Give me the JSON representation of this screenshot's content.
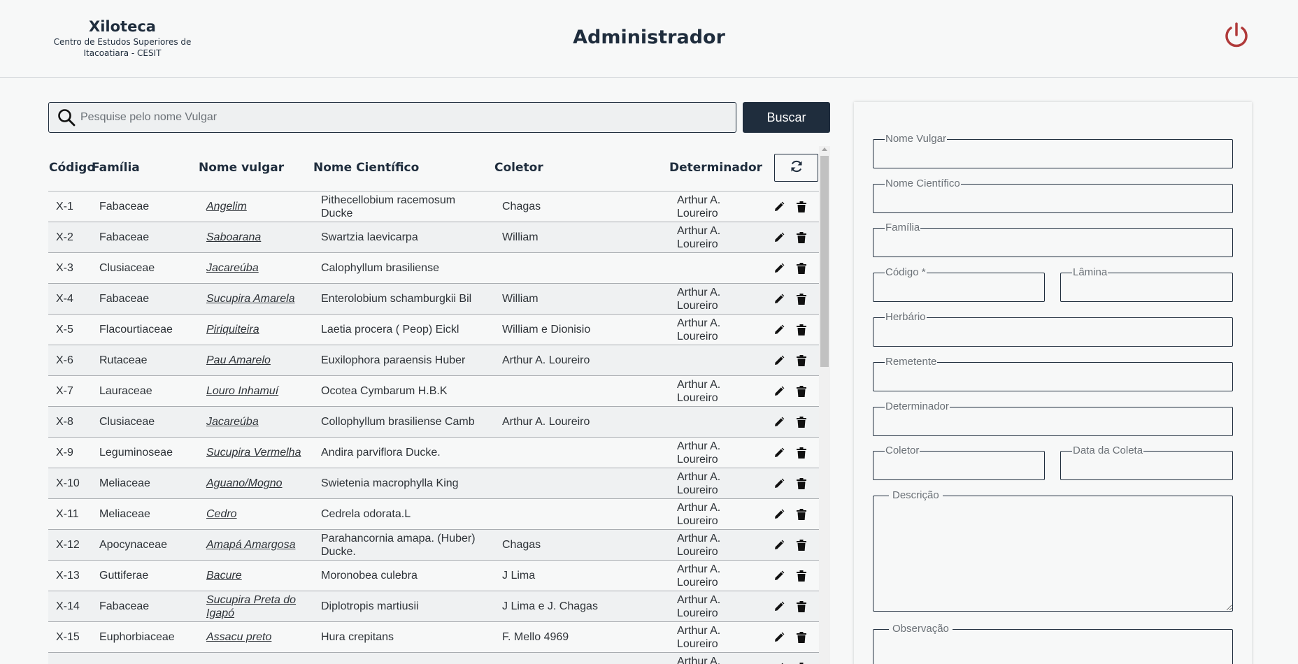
{
  "header": {
    "brand_title": "Xiloteca",
    "brand_subtitle": "Centro de Estudos Superiores de Itacoatiara - CESIT",
    "page_title": "Administrador"
  },
  "search": {
    "placeholder": "Pesquise pelo nome Vulgar",
    "value": "",
    "button_label": "Buscar"
  },
  "table": {
    "columns": [
      "Código",
      "Família",
      "Nome vulgar",
      "Nome Científico",
      "Coletor",
      "Determinador"
    ],
    "rows": [
      {
        "codigo": "X-1",
        "familia": "Fabaceae",
        "nome_vulgar": "Angelim",
        "nome_cientifico": "Pithecellobium racemosum Ducke",
        "coletor": "Chagas",
        "determinador": "Arthur A. Loureiro"
      },
      {
        "codigo": "X-2",
        "familia": "Fabaceae",
        "nome_vulgar": "Saboarana",
        "nome_cientifico": "Swartzia laevicarpa",
        "coletor": "William",
        "determinador": "Arthur A. Loureiro"
      },
      {
        "codigo": "X-3",
        "familia": "Clusiaceae",
        "nome_vulgar": "Jacareúba",
        "nome_cientifico": "Calophyllum brasiliense",
        "coletor": "",
        "determinador": ""
      },
      {
        "codigo": "X-4",
        "familia": "Fabaceae",
        "nome_vulgar": "Sucupira Amarela",
        "nome_cientifico": "Enterolobium schamburgkii Bil",
        "coletor": "William",
        "determinador": "Arthur A. Loureiro"
      },
      {
        "codigo": "X-5",
        "familia": "Flacourtiaceae",
        "nome_vulgar": "Piriquiteira",
        "nome_cientifico": "Laetia procera ( Peop) Eickl",
        "coletor": "William e Dionisio",
        "determinador": "Arthur A. Loureiro"
      },
      {
        "codigo": "X-6",
        "familia": "Rutaceae",
        "nome_vulgar": "Pau Amarelo",
        "nome_cientifico": "Euxilophora paraensis Huber",
        "coletor": "Arthur A. Loureiro",
        "determinador": ""
      },
      {
        "codigo": "X-7",
        "familia": "Lauraceae",
        "nome_vulgar": "Louro Inhamuí",
        "nome_cientifico": "Ocotea Cymbarum H.B.K",
        "coletor": "",
        "determinador": "Arthur A. Loureiro"
      },
      {
        "codigo": "X-8",
        "familia": "Clusiaceae",
        "nome_vulgar": "Jacareúba",
        "nome_cientifico": "Collophyllum brasiliense Camb",
        "coletor": "Arthur A. Loureiro",
        "determinador": ""
      },
      {
        "codigo": "X-9",
        "familia": "Leguminoseae",
        "nome_vulgar": "Sucupira Vermelha",
        "nome_cientifico": "Andira parviflora Ducke.",
        "coletor": "",
        "determinador": "Arthur A. Loureiro"
      },
      {
        "codigo": "X-10",
        "familia": "Meliaceae",
        "nome_vulgar": "Aguano/Mogno",
        "nome_cientifico": "Swietenia macrophylla King",
        "coletor": "",
        "determinador": "Arthur A. Loureiro"
      },
      {
        "codigo": "X-11",
        "familia": "Meliaceae",
        "nome_vulgar": "Cedro",
        "nome_cientifico": "Cedrela odorata.L",
        "coletor": "",
        "determinador": "Arthur A. Loureiro"
      },
      {
        "codigo": "X-12",
        "familia": "Apocynaceae",
        "nome_vulgar": "Amapá Amargosa",
        "nome_cientifico": "Parahancornia amapa. (Huber) Ducke.",
        "coletor": "Chagas",
        "determinador": "Arthur A. Loureiro"
      },
      {
        "codigo": "X-13",
        "familia": "Guttiferae",
        "nome_vulgar": "Bacure",
        "nome_cientifico": "Moronobea culebra",
        "coletor": "J Lima",
        "determinador": "Arthur A. Loureiro"
      },
      {
        "codigo": "X-14",
        "familia": "Fabaceae",
        "nome_vulgar": "Sucupira Preta do Igapó",
        "nome_cientifico": "Diplotropis martiusii",
        "coletor": "J Lima e J. Chagas",
        "determinador": "Arthur A. Loureiro"
      },
      {
        "codigo": "X-15",
        "familia": "Euphorbiaceae",
        "nome_vulgar": "Assacu preto",
        "nome_cientifico": "Hura crepitans",
        "coletor": "F. Mello 4969",
        "determinador": "Arthur A. Loureiro"
      },
      {
        "codigo": "",
        "familia": "",
        "nome_vulgar": "",
        "nome_cientifico": "",
        "coletor": "",
        "determinador": "Arthur A. Loureiro"
      }
    ]
  },
  "form": {
    "nome_vulgar_label": "Nome Vulgar",
    "nome_cientifico_label": "Nome Científico",
    "familia_label": "Família",
    "codigo_label": "Código *",
    "lamina_label": "Lâmina",
    "herbario_label": "Herbário",
    "remetente_label": "Remetente",
    "determinador_label": "Determinador",
    "coletor_label": "Coletor",
    "data_coleta_label": "Data da Coleta",
    "descricao_label": "Descrição",
    "observacao_label": "Observação"
  },
  "colors": {
    "primary": "#1f2d3d",
    "power": "#b03a3a",
    "background": "#f7f8f8"
  },
  "icons": {
    "logout": "power-icon",
    "search": "search-icon",
    "refresh": "refresh-icon",
    "edit": "pencil-icon",
    "delete": "trash-icon"
  }
}
